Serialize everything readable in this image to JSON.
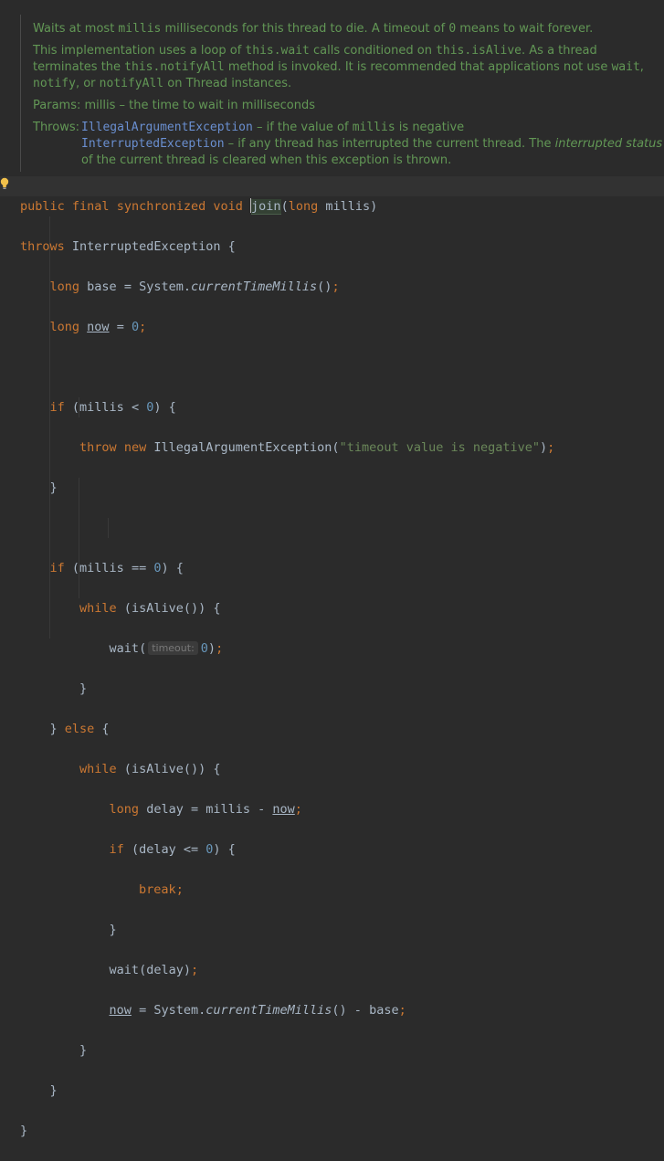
{
  "doc": {
    "p1_a": "Waits at most ",
    "p1_code1": "millis",
    "p1_b": " milliseconds for this thread to die. A timeout of ",
    "p1_code2": "0",
    "p1_c": " means to wait forever.",
    "p2_a": "This implementation uses a loop of ",
    "p2_code1": "this.wait",
    "p2_b": " calls conditioned on ",
    "p2_code2": "this.isAlive",
    "p2_c": ". As a thread terminates the ",
    "p2_code3": "this.notifyAll",
    "p2_d": " method is invoked. It is recommended that applications not use ",
    "p2_code4": "wait",
    "p2_e": ", ",
    "p2_code5": "notify",
    "p2_f": ", or ",
    "p2_code6": "notifyAll",
    "p2_g": " on ",
    "p2_code7": "Thread",
    "p2_h": " instances.",
    "params_label": "Params:",
    "params_text": " millis – the time to wait in milliseconds",
    "throws_label": "Throws:",
    "throws1_link": "IllegalArgumentException",
    "throws1_a": " – if the value of ",
    "throws1_code": "millis",
    "throws1_b": " is negative",
    "throws2_link": "InterruptedException",
    "throws2_a": " – if any thread has interrupted the current thread. The ",
    "throws2_it": "interrupted status",
    "throws2_b": " of the current thread is cleared when this exception is thrown."
  },
  "code": {
    "kw_public": "public",
    "kw_final": "final",
    "kw_synchronized": "synchronized",
    "kw_void": "void",
    "method_join": "join",
    "kw_long": "long",
    "kw_throws": "throws",
    "kw_if": "if",
    "kw_throw": "throw",
    "kw_new": "new",
    "kw_while": "while",
    "kw_else": "else",
    "kw_break": "break",
    "param_millis": "millis",
    "exc_interrupted": "InterruptedException",
    "exc_illegal": "IllegalArgumentException",
    "var_base": "base",
    "var_now": "now",
    "var_delay": "delay",
    "cls_system": "System",
    "fn_ctm": "currentTimeMillis",
    "fn_isalive": "isAlive",
    "fn_wait": "wait",
    "num_zero": "0",
    "str_timeout": "\"timeout value is negative\"",
    "hint_timeout": "timeout:"
  },
  "colors": {
    "background": "#2b2b2b",
    "keyword": "#cc7832",
    "number": "#6897bb",
    "string": "#6a8759",
    "identifier": "#a9b7c6",
    "doc_text": "#629755",
    "doc_link": "#6a8fd0",
    "bulb": "#f2c14b"
  },
  "icons": {
    "gutter": "lightbulb-icon"
  }
}
